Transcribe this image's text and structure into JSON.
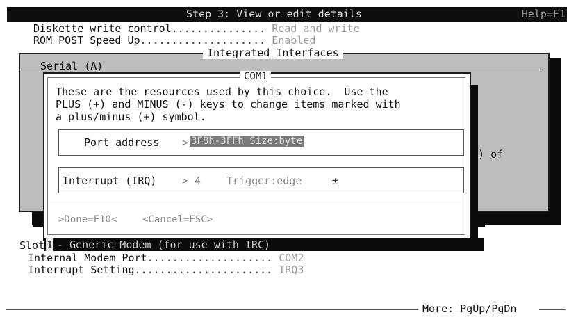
{
  "header": {
    "title": "Step 3:  View or edit details",
    "help": "Help=F1"
  },
  "background_settings": [
    {
      "label": "Diskette write control",
      "dots": "...............",
      "value": "Read and write"
    },
    {
      "label": "ROM POST Speed Up",
      "dots": "....................",
      "value": "Enabled"
    }
  ],
  "integrated_window": {
    "title": "Integrated Interfaces",
    "section": "Serial (A)",
    "partial_text": "mory) of"
  },
  "com_dialog": {
    "title": "COM1",
    "description": [
      "These are the resources used by this choice.  Use the",
      "PLUS (+) and MINUS (-) keys to change items marked with",
      "a plus/minus (+) symbol."
    ],
    "port": {
      "label": "Port address",
      "marker": ">",
      "value": "3F8h-3FFh   Size:byte"
    },
    "irq": {
      "label": "Interrupt (IRQ)",
      "value": "> 4",
      "trigger": "Trigger:edge",
      "plus": "±"
    },
    "buttons": {
      "done": ">Done=F10<",
      "cancel": "<Cancel=ESC>"
    }
  },
  "slot": {
    "label": "Slot",
    "number": "1",
    "description": "- Generic Modem (for use with IRC)",
    "settings": [
      {
        "label": "Internal Modem Port",
        "dots": "....................",
        "value": "COM2"
      },
      {
        "label": "Interrupt Setting",
        "dots": "......................",
        "value": "IRQ3"
      }
    ]
  },
  "footer": {
    "more": "More: PgUp/PgDn"
  }
}
